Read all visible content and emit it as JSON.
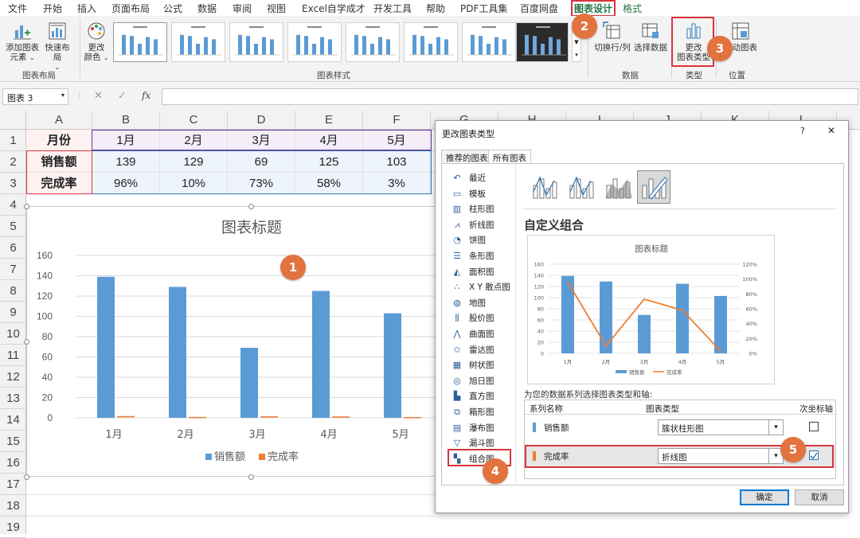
{
  "menu": {
    "tabs": [
      "文件",
      "开始",
      "插入",
      "页面布局",
      "公式",
      "数据",
      "审阅",
      "视图",
      "Excel自学成才",
      "开发工具",
      "帮助",
      "PDF工具集",
      "百度网盘",
      "图表设计",
      "格式"
    ],
    "active": "图表设计"
  },
  "ribbon": {
    "add_element": "添加图表\n元素",
    "quick_layout": "快速布局",
    "change_colors": "更改\n颜色",
    "group_layout": "图表布局",
    "group_styles": "图表样式",
    "switch_row_col": "切换行/列",
    "select_data": "选择数据",
    "group_data": "数据",
    "change_type": "更改\n图表类型",
    "group_type": "类型",
    "move_chart": "移动图表",
    "group_location": "位置"
  },
  "formula_bar": {
    "name_box": "图表 3",
    "fx": "fx",
    "value": ""
  },
  "columns": [
    "A",
    "B",
    "C",
    "D",
    "E",
    "F",
    "G",
    "H",
    "I",
    "J",
    "K",
    "L"
  ],
  "rows": [
    "1",
    "2",
    "3",
    "4",
    "5",
    "6",
    "7",
    "8",
    "9",
    "10",
    "11",
    "12",
    "13",
    "14",
    "15",
    "16",
    "17",
    "18",
    "19"
  ],
  "sheet": {
    "row1": [
      "月份",
      "1月",
      "2月",
      "3月",
      "4月",
      "5月"
    ],
    "row2": [
      "销售额",
      "139",
      "129",
      "69",
      "125",
      "103"
    ],
    "row3": [
      "完成率",
      "96%",
      "10%",
      "73%",
      "58%",
      "3%"
    ]
  },
  "colors": {
    "bar": "#5b9bd5",
    "line": "#ed7d31",
    "accent_red": "#d9343b",
    "badge": "#e2733f",
    "excel_green": "#217346"
  },
  "chart_data": [
    {
      "type": "bar",
      "title": "图表标题",
      "categories": [
        "1月",
        "2月",
        "3月",
        "4月",
        "5月"
      ],
      "series": [
        {
          "name": "销售额",
          "values": [
            139,
            129,
            69,
            125,
            103
          ]
        },
        {
          "name": "完成率",
          "values": [
            0.96,
            0.1,
            0.73,
            0.58,
            0.03
          ]
        }
      ],
      "yticks": [
        "0",
        "20",
        "40",
        "60",
        "80",
        "100",
        "120",
        "140",
        "160"
      ],
      "ylim": [
        0,
        160
      ],
      "legend": "bottom"
    },
    {
      "type": "combo",
      "title": "图表标题",
      "categories": [
        "1月",
        "2月",
        "3月",
        "4月",
        "5月"
      ],
      "series": [
        {
          "name": "销售额",
          "type": "bar",
          "values": [
            139,
            129,
            69,
            125,
            103
          ]
        },
        {
          "name": "完成率",
          "type": "line",
          "axis": "secondary",
          "values": [
            0.96,
            0.1,
            0.73,
            0.58,
            0.03
          ]
        }
      ],
      "yticks": [
        "0",
        "20",
        "40",
        "60",
        "80",
        "100",
        "120",
        "140",
        "160"
      ],
      "y2ticks": [
        "0%",
        "20%",
        "40%",
        "60%",
        "80%",
        "100%",
        "120%"
      ],
      "ylim": [
        0,
        160
      ],
      "y2lim": [
        0,
        1.2
      ],
      "legend": "bottom"
    }
  ],
  "dialog": {
    "title": "更改图表类型",
    "help": "?",
    "close": "✕",
    "tabs": [
      "推荐的图表",
      "所有图表"
    ],
    "categories": [
      "最近",
      "模板",
      "柱形图",
      "折线图",
      "饼图",
      "条形图",
      "面积图",
      "X Y 散点图",
      "地图",
      "股价图",
      "曲面图",
      "雷达图",
      "树状图",
      "旭日图",
      "直方图",
      "箱形图",
      "瀑布图",
      "漏斗图",
      "组合图"
    ],
    "section_title": "自定义组合",
    "series_prompt": "为您的数据系列选择图表类型和轴:",
    "table_headers": [
      "系列名称",
      "图表类型",
      "次坐标轴"
    ],
    "series_rows": [
      {
        "name": "销售额",
        "chart_type": "簇状柱形图",
        "secondary": false
      },
      {
        "name": "完成率",
        "chart_type": "折线图",
        "secondary": true
      }
    ],
    "ok": "确定",
    "cancel": "取消"
  },
  "badges": [
    "1",
    "2",
    "3",
    "4",
    "5"
  ]
}
